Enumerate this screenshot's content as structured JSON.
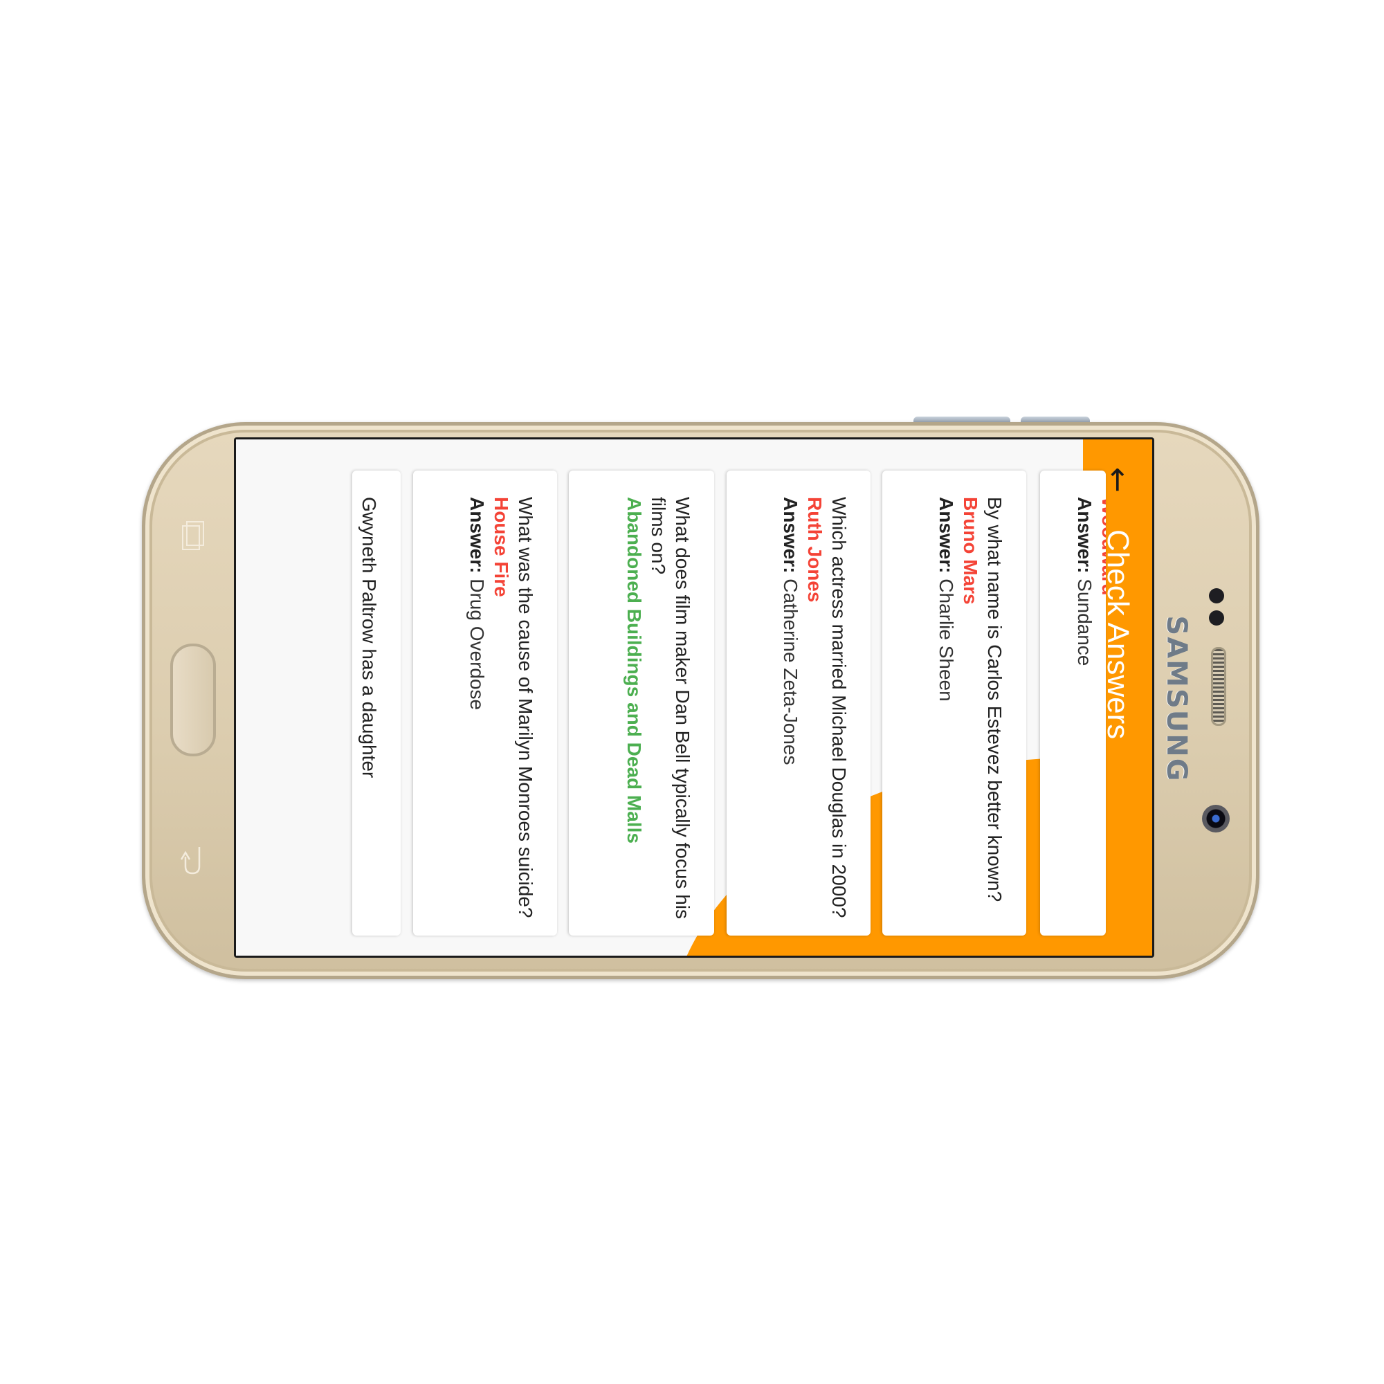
{
  "device": {
    "brand": "SAMSUNG"
  },
  "colors": {
    "accent": "#ff9800",
    "wrong": "#f44336",
    "correct": "#4caf50"
  },
  "header": {
    "back_icon": "arrow-left-icon",
    "title": "Check Answers"
  },
  "answer_label": "Answer:",
  "cards": [
    {
      "question": "",
      "user_answer": "Woodward",
      "user_answer_status": "wrong",
      "answer": "Sundance"
    },
    {
      "question": "By what name is Carlos Estevez better known?",
      "user_answer": "Bruno Mars",
      "user_answer_status": "wrong",
      "answer": "Charlie Sheen"
    },
    {
      "question": "Which actress married Michael Douglas in 2000?",
      "user_answer": "Ruth Jones",
      "user_answer_status": "wrong",
      "answer": "Catherine Zeta-Jones"
    },
    {
      "question": "What does film maker Dan Bell typically focus his films on?",
      "user_answer": "Abandoned Buildings and Dead Malls",
      "user_answer_status": "correct",
      "answer": ""
    },
    {
      "question": "What was the cause of Marilyn Monroes suicide?",
      "user_answer": "House Fire",
      "user_answer_status": "wrong",
      "answer": "Drug Overdose"
    },
    {
      "question": "Gwyneth Paltrow has a daughter",
      "user_answer": "",
      "user_answer_status": "",
      "answer": ""
    }
  ]
}
